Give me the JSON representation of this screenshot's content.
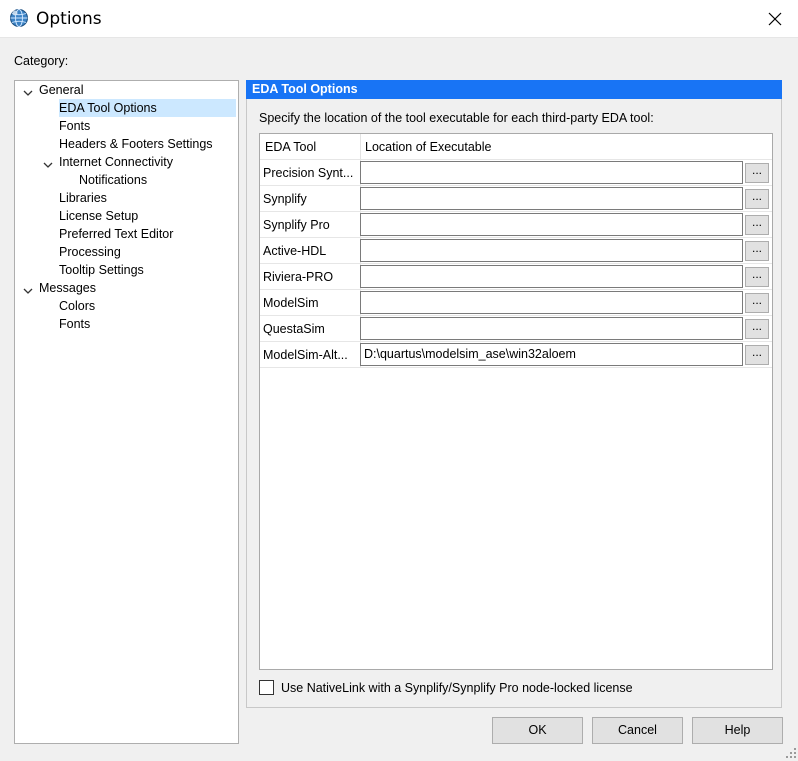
{
  "window": {
    "title": "Options"
  },
  "category_label": "Category:",
  "tree": [
    {
      "label": "General",
      "level": 0,
      "expanded": true
    },
    {
      "label": "EDA Tool Options",
      "level": 1,
      "selected": true
    },
    {
      "label": "Fonts",
      "level": 1
    },
    {
      "label": "Headers & Footers Settings",
      "level": 1
    },
    {
      "label": "Internet Connectivity",
      "level": 1,
      "expanded": true
    },
    {
      "label": "Notifications",
      "level": 2
    },
    {
      "label": "Libraries",
      "level": 1
    },
    {
      "label": "License Setup",
      "level": 1
    },
    {
      "label": "Preferred Text Editor",
      "level": 1
    },
    {
      "label": "Processing",
      "level": 1
    },
    {
      "label": "Tooltip Settings",
      "level": 1
    },
    {
      "label": "Messages",
      "level": 0,
      "expanded": true
    },
    {
      "label": "Colors",
      "level": 1
    },
    {
      "label": "Fonts",
      "level": 1
    }
  ],
  "panel": {
    "title": "EDA Tool Options",
    "description": "Specify the location of the tool executable for each third-party EDA tool:"
  },
  "table": {
    "headers": [
      "EDA Tool",
      "Location of Executable"
    ],
    "rows": [
      {
        "tool": "Precision Synt...",
        "path": ""
      },
      {
        "tool": "Synplify",
        "path": ""
      },
      {
        "tool": "Synplify Pro",
        "path": ""
      },
      {
        "tool": "Active-HDL",
        "path": ""
      },
      {
        "tool": "Riviera-PRO",
        "path": ""
      },
      {
        "tool": "ModelSim",
        "path": ""
      },
      {
        "tool": "QuestaSim",
        "path": ""
      },
      {
        "tool": "ModelSim-Alt...",
        "path": "D:\\quartus\\modelsim_ase\\win32aloem"
      }
    ],
    "browse_label": "..."
  },
  "nativelink": {
    "label": "Use NativeLink with a Synplify/Synplify Pro node-locked license",
    "checked": false
  },
  "buttons": {
    "ok": "OK",
    "cancel": "Cancel",
    "help": "Help"
  },
  "colors": {
    "panel_title_bg": "#1874f5",
    "selection_bg": "#cce8ff"
  }
}
